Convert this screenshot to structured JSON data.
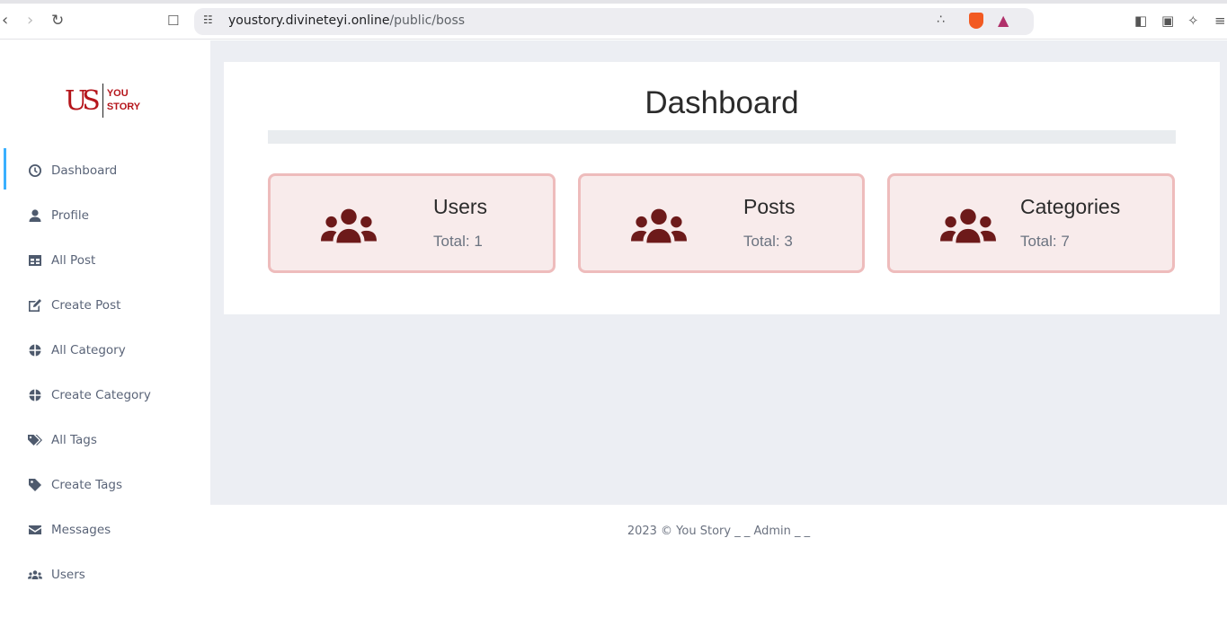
{
  "browser": {
    "url_host": "youstory.divineteyi.online",
    "url_path": "/public/boss",
    "icons": [
      "back-icon",
      "forward-icon",
      "reload-icon",
      "bookmark-icon",
      "site-settings-icon",
      "share-icon",
      "brave-shields-icon",
      "rewards-icon",
      "sidebar-icon",
      "wallet-icon",
      "leo-ai-icon",
      "menu-icon"
    ]
  },
  "sidebar": {
    "logo": {
      "monogram": "US",
      "line1": "YOU",
      "line2": "STORY"
    },
    "items": [
      {
        "label": "Dashboard",
        "icon": "clock-icon",
        "active": true
      },
      {
        "label": "Profile",
        "icon": "user-icon"
      },
      {
        "label": "All Post",
        "icon": "table-icon"
      },
      {
        "label": "Create Post",
        "icon": "edit-icon"
      },
      {
        "label": "All Category",
        "icon": "globe-icon"
      },
      {
        "label": "Create Category",
        "icon": "globe-icon"
      },
      {
        "label": "All Tags",
        "icon": "tags-icon"
      },
      {
        "label": "Create Tags",
        "icon": "tag-icon"
      },
      {
        "label": "Messages",
        "icon": "envelope-icon"
      },
      {
        "label": "Users",
        "icon": "users-icon"
      }
    ]
  },
  "main": {
    "title": "Dashboard",
    "cards": [
      {
        "title": "Users",
        "total": "Total: 1"
      },
      {
        "title": "Posts",
        "total": "Total: 3"
      },
      {
        "title": "Categories",
        "total": "Total: 7"
      }
    ],
    "colors": {
      "icon": "#6d1a1a",
      "card_bg": "#f8ebeb",
      "card_border": "#eebcbc",
      "accent": "#3ab0ff"
    }
  },
  "footer": {
    "text": "2023 © You Story _ _ Admin _ _"
  }
}
